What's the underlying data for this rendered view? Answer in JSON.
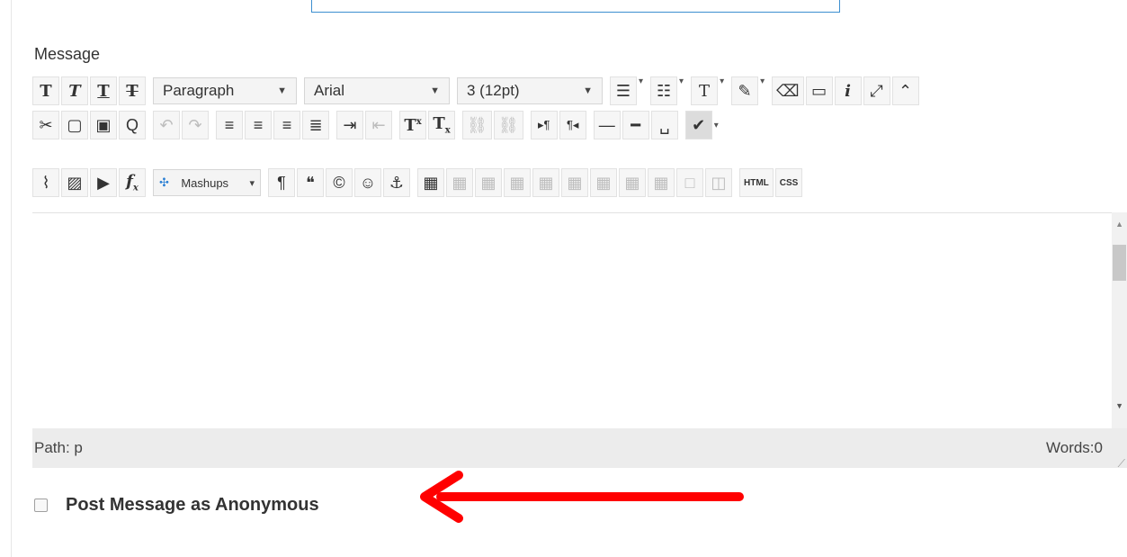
{
  "form": {
    "message_label": "Message"
  },
  "toolbar": {
    "format_block": "Paragraph",
    "font_family": "Arial",
    "font_size": "3 (12pt)",
    "mashups_label": "Mashups",
    "html_label": "HTML",
    "css_label": "CSS",
    "superscript_label": "T",
    "subscript_label": "T"
  },
  "status_bar": {
    "path": "Path: p",
    "word_count": "Words:0"
  },
  "anonymous": {
    "label": "Post Message as Anonymous",
    "checked": false
  },
  "colors": {
    "annotation_arrow": "#ff0000",
    "input_border": "#3d8fd0"
  }
}
